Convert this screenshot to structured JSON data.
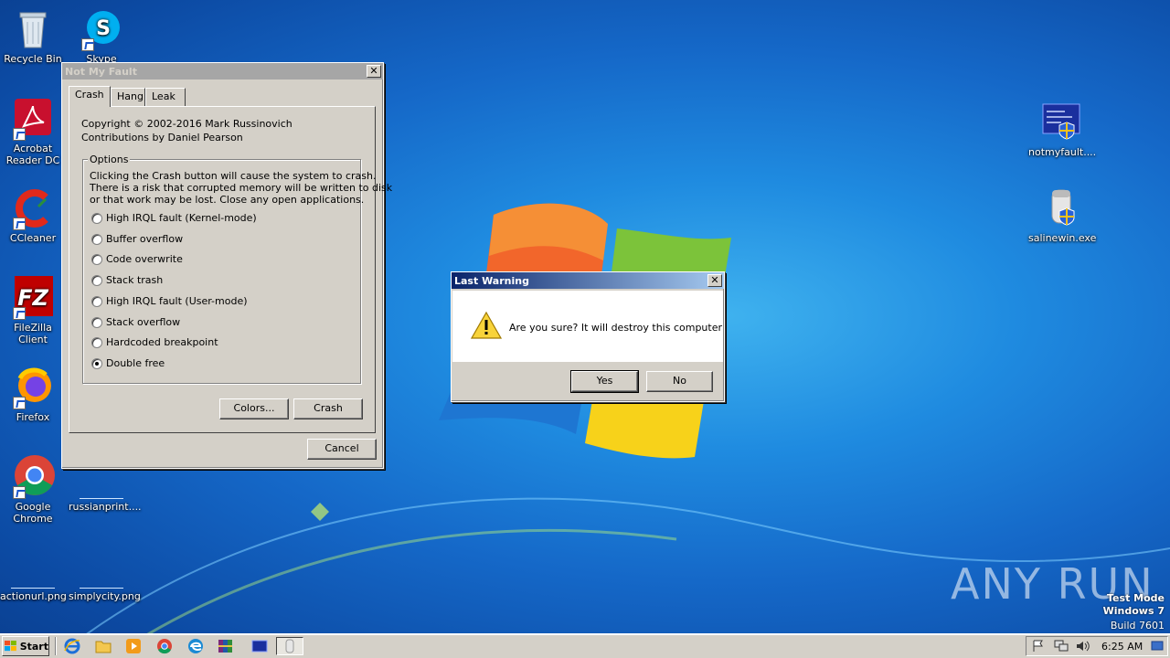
{
  "desktop": {
    "icons": [
      {
        "label": "Recycle Bin",
        "icon": "recycle-bin-icon"
      },
      {
        "label": "Skype",
        "icon": "skype-icon"
      },
      {
        "label": "Acrobat Reader DC",
        "icon": "acrobat-icon"
      },
      {
        "label": "CCleaner",
        "icon": "ccleaner-icon"
      },
      {
        "label": "FileZilla Client",
        "icon": "filezilla-icon"
      },
      {
        "label": "Firefox",
        "icon": "firefox-icon"
      },
      {
        "label": "Google Chrome",
        "icon": "chrome-icon"
      },
      {
        "label": "russianprint....",
        "icon": "blank-file-icon"
      },
      {
        "label": "actionurl.png",
        "icon": "blank-file-icon"
      },
      {
        "label": "simplycity.png",
        "icon": "blank-file-icon"
      },
      {
        "label": "notmyfault....",
        "icon": "notmyfault-icon"
      },
      {
        "label": "salinewin.exe",
        "icon": "salinewin-icon"
      }
    ]
  },
  "main_window": {
    "title": "Not My Fault",
    "tabs": [
      "Crash",
      "Hang",
      "Leak"
    ],
    "selected_tab": "Crash",
    "copyright": "Copyright © 2002-2016 Mark Russinovich",
    "contributions": "Contributions by Daniel Pearson",
    "options_label": "Options",
    "description_lines": [
      "Clicking the Crash button will cause the system to crash.",
      "There is a risk that corrupted memory will be written to disk",
      "or that work may be lost. Close any open applications."
    ],
    "options": [
      {
        "label": "High IRQL fault (Kernel-mode)",
        "selected": false
      },
      {
        "label": "Buffer overflow",
        "selected": false
      },
      {
        "label": "Code overwrite",
        "selected": false
      },
      {
        "label": "Stack trash",
        "selected": false
      },
      {
        "label": "High IRQL fault (User-mode)",
        "selected": false
      },
      {
        "label": "Stack overflow",
        "selected": false
      },
      {
        "label": "Hardcoded breakpoint",
        "selected": false
      },
      {
        "label": "Double free",
        "selected": true
      }
    ],
    "colors_button": "Colors...",
    "crash_button": "Crash",
    "cancel_button": "Cancel",
    "close_glyph": "✕"
  },
  "dialog": {
    "title": "Last Warning",
    "message": "Are you sure? It will destroy this computer",
    "icon": "warning-icon",
    "yes_button": "Yes",
    "no_button": "No",
    "close_glyph": "✕"
  },
  "taskbar": {
    "start_label": "Start",
    "clock": "6:25 AM",
    "pinned": [
      "ie-icon",
      "explorer-icon",
      "media-player-icon",
      "chrome-icon",
      "edge-icon",
      "winrar-icon",
      "notmyfault-task-icon",
      "salinewin-task-icon"
    ]
  },
  "watermark": {
    "brand": "ANY RUN",
    "test_mode": "Test Mode",
    "os": "Windows 7",
    "build": "Build 7601"
  }
}
